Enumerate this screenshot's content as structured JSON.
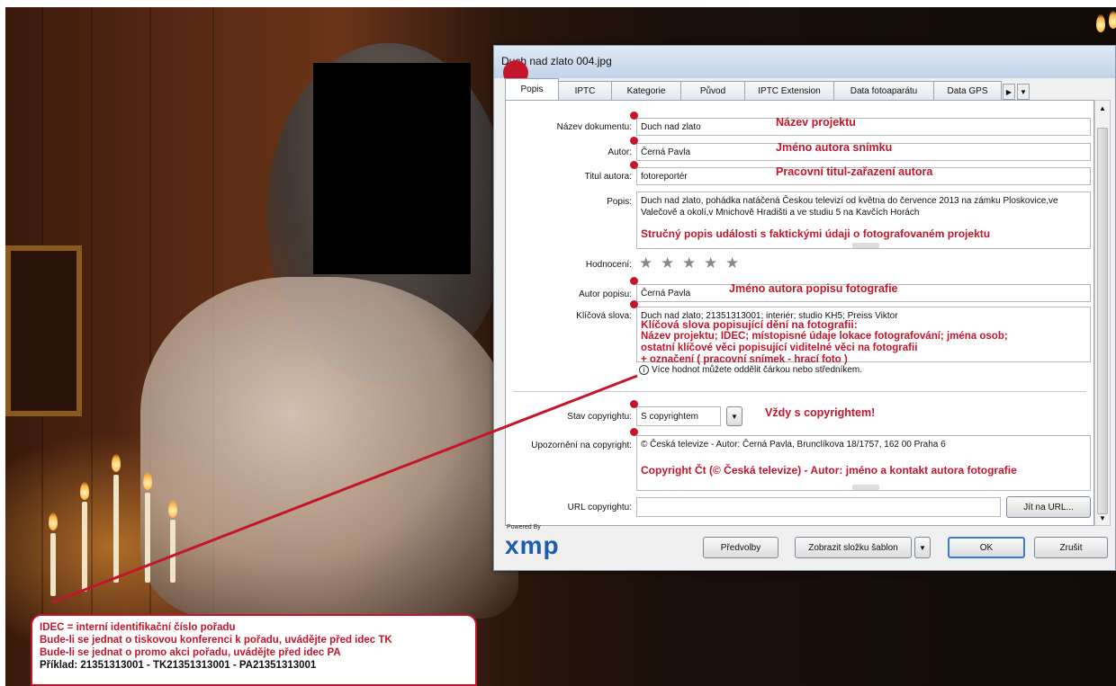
{
  "window": {
    "title": "Duch nad zlato 004.jpg"
  },
  "tabs": [
    {
      "label": "Popis",
      "active": true
    },
    {
      "label": "IPTC"
    },
    {
      "label": "Kategorie"
    },
    {
      "label": "Původ"
    },
    {
      "label": "IPTC Extension"
    },
    {
      "label": "Data fotoaparátu"
    },
    {
      "label": "Data GPS"
    }
  ],
  "form": {
    "document_title": {
      "label": "Název dokumentu:",
      "value": "Duch nad zlato"
    },
    "author": {
      "label": "Autor:",
      "value": "Černá Pavla"
    },
    "author_title": {
      "label": "Titul autora:",
      "value": "fotoreportér"
    },
    "description": {
      "label": "Popis:",
      "value": "Duch nad zlato, pohádka natáčená Českou televizí od května do července 2013 na zámku Ploskovice,ve Valečově a okolí,v Mnichově Hradišti a ve studiu 5 na Kavčích Horách"
    },
    "rating": {
      "label": "Hodnocení:",
      "stars": 5
    },
    "description_author": {
      "label": "Autor popisu:",
      "value": "Černá Pavla"
    },
    "keywords": {
      "label": "Klíčová slova:",
      "value": "Duch nad zlato; 21351313001; interiér; studio KH5; Preiss Viktor",
      "hint": "Více hodnot můžete oddělit čárkou nebo středníkem."
    },
    "copyright_status": {
      "label": "Stav copyrightu:",
      "value": "S copyrightem"
    },
    "copyright_notice": {
      "label": "Upozornění na copyright:",
      "value": "© Česká televize - Autor: Černá Pavla, Brunclíkova 18/1757, 162 00 Praha 6"
    },
    "copyright_url": {
      "label": "URL copyrightu:",
      "value": "",
      "go_button": "Jít na URL..."
    }
  },
  "annotations": {
    "title": "Název projektu",
    "author": "Jméno autora snímku",
    "author_title": "Pracovní titul-zařazení autora",
    "description": "Stručný popis události s faktickými údaji o fotografovaném projektu",
    "description_author": "Jméno autora popisu fotografie",
    "keywords": [
      "Klíčová slova popisující dění na fotografii:",
      "Název projektu; IDEC; místopisné údaje lokace fotografování; jména osob;",
      "ostatní klíčové věci popisující viditelné věci na fotografii",
      "+ označení ( pracovní snímek - hrací foto )"
    ],
    "copyright_status": "Vždy s copyrightem!",
    "copyright_notice": "Copyright Čt (© Česká televize) - Autor: jméno a kontakt autora fotografie"
  },
  "footer": {
    "powered_by": "Powered By",
    "logo": "xmp",
    "preferences": "Předvolby",
    "show_templates": "Zobrazit složku šablon",
    "ok": "OK",
    "cancel": "Zrušit"
  },
  "callout": {
    "lines": [
      "IDEC = interní identifikační číslo pořadu",
      "Bude-li se jednat o tiskovou konferenci k pořadu, uvádějte před idec TK",
      "Bude-li se jednat o promo akci pořadu, uvádějte před idec PA",
      "Příklad: 21351313001 - TK21351313001 - PA21351313001"
    ]
  },
  "colors": {
    "annotation": "#c4162a",
    "xmp_logo": "#1b5db0"
  }
}
